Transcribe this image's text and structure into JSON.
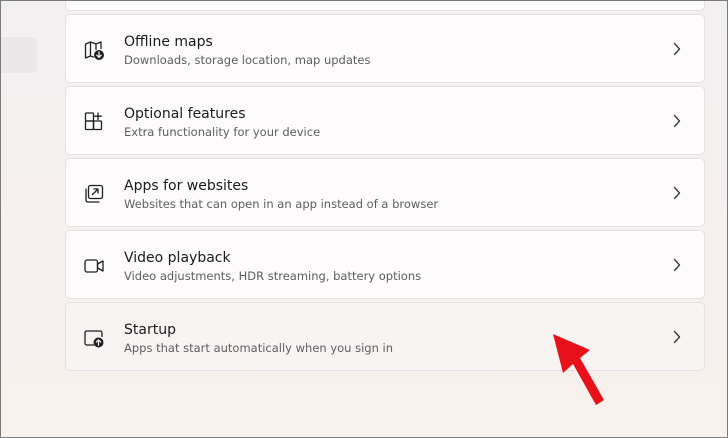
{
  "settings_list": {
    "items": [
      {
        "id": "offline-maps",
        "title": "Offline maps",
        "description": "Downloads, storage location, map updates",
        "icon": "map-download-icon"
      },
      {
        "id": "optional-features",
        "title": "Optional features",
        "description": "Extra functionality for your device",
        "icon": "grid-plus-icon"
      },
      {
        "id": "apps-for-websites",
        "title": "Apps for websites",
        "description": "Websites that can open in an app instead of a browser",
        "icon": "open-in-app-icon"
      },
      {
        "id": "video-playback",
        "title": "Video playback",
        "description": "Video adjustments, HDR streaming, battery options",
        "icon": "video-camera-icon"
      },
      {
        "id": "startup",
        "title": "Startup",
        "description": "Apps that start automatically when you sign in",
        "icon": "startup-app-icon"
      }
    ]
  },
  "annotation": {
    "icon": "red-pointer-arrow-icon",
    "color": "#e8111a"
  },
  "colors": {
    "card_background": "#fdfbfb",
    "card_border": "#e6e1e2",
    "title_text": "#1b1b1b",
    "description_text": "#5e5e5e"
  }
}
